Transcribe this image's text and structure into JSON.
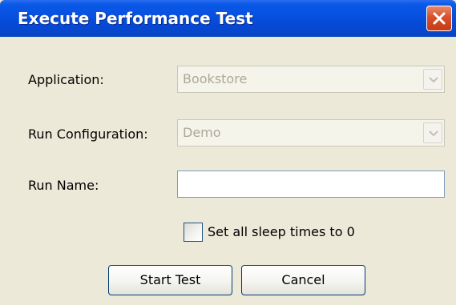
{
  "window": {
    "title": "Execute Performance Test",
    "close_icon": "close-icon",
    "accent_color": "#0a56e0"
  },
  "form": {
    "application_label": "Application:",
    "application_value": "Bookstore",
    "run_config_label": "Run Configuration:",
    "run_config_value": "Demo",
    "run_name_label": "Run Name:",
    "run_name_value": "",
    "sleep_checkbox_label": "Set all sleep times to 0",
    "sleep_checkbox_checked": false
  },
  "buttons": {
    "start_label": "Start Test",
    "cancel_label": "Cancel"
  }
}
